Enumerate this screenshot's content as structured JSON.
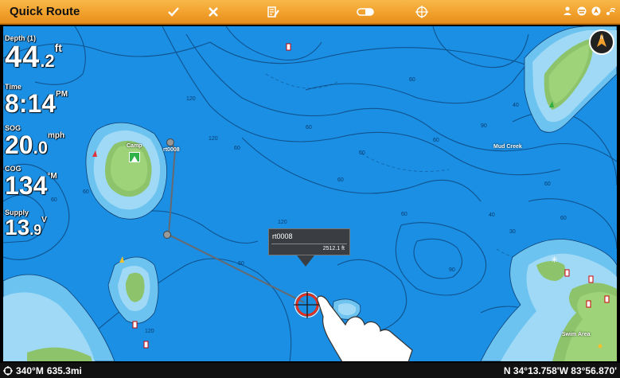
{
  "toolbar": {
    "title": "Quick Route",
    "buttons": [
      {
        "name": "accept-route-button",
        "icon": "checkmark-icon"
      },
      {
        "name": "cancel-route-button",
        "icon": "x-icon"
      },
      {
        "name": "edit-route-button",
        "icon": "edit-list-icon"
      },
      {
        "name": "navigate-route-button",
        "icon": "route-toggle-icon"
      },
      {
        "name": "cursor-waypoint-button",
        "icon": "crosshair-icon"
      }
    ],
    "status_icons": [
      "anchor-person-icon",
      "sonar-icon",
      "gps-icon",
      "signal-icon"
    ],
    "accent_color": "#f2a12d"
  },
  "readouts": {
    "depth": {
      "label": "Depth (1)",
      "value": "44",
      "decimal": ".2",
      "unit": "ft"
    },
    "time": {
      "label": "Time",
      "value": "8:14",
      "unit": "PM"
    },
    "sog": {
      "label": "SOG",
      "value": "20",
      "decimal": ".0",
      "unit": "mph"
    },
    "cog": {
      "label": "COG",
      "value": "134",
      "unit": "°M"
    },
    "supply": {
      "label": "Supply",
      "value": "13",
      "decimal": ".9",
      "unit": "V"
    }
  },
  "map": {
    "water_color": "#1a8fe4",
    "labels": {
      "camp": "Camp",
      "route": "rt0008",
      "mud_creek": "Mud Creek",
      "swim_area": "Swim Area"
    },
    "contours": [
      "120",
      "60",
      "60",
      "120",
      "60",
      "60",
      "120",
      "60",
      "90",
      "60",
      "40",
      "60",
      "60",
      "30",
      "60",
      "60",
      "120",
      "60",
      "60",
      "40",
      "90"
    ],
    "popup": {
      "name": "rt0008",
      "distance": "2512.1 ft"
    },
    "scale": "500ft",
    "compass": "north-up-compass-icon"
  },
  "status_bar": {
    "heading": "340°M",
    "distance": "635.3mi",
    "position": "N 34°13.758'W 83°56.870'"
  }
}
